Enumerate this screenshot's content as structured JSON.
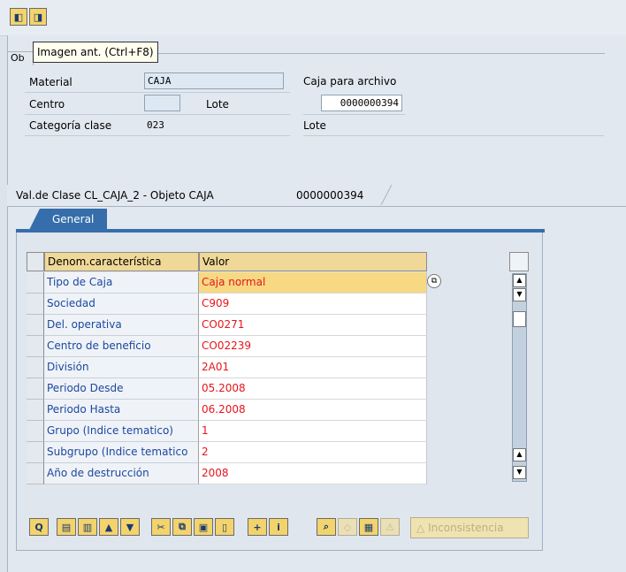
{
  "toolbar": {
    "prev_icon": "previous-screen-icon",
    "next_icon": "next-screen-icon",
    "tooltip": "Imagen ant.  (Ctrl+F8)"
  },
  "object": {
    "group_label": "Ob",
    "material_label": "Material",
    "material_value": "CAJA",
    "caja_archivo_label": "Caja para archivo",
    "centro_label": "Centro",
    "centro_value": "",
    "lote_label": "Lote",
    "lote_value": "0000000394",
    "categoria_label": "Categoría clase",
    "categoria_value": "023",
    "lote2_label": "Lote"
  },
  "section": {
    "title": "Val.de Clase CL_CAJA_2 - Objeto CAJA",
    "value": "0000000394",
    "tab_general": "General"
  },
  "table": {
    "header_name": "Denom.característica",
    "header_value": "Valor",
    "rows": [
      {
        "name": "Tipo de Caja",
        "value": "Caja normal"
      },
      {
        "name": "Sociedad",
        "value": "C909"
      },
      {
        "name": "Del. operativa",
        "value": "CO0271"
      },
      {
        "name": "Centro de beneficio",
        "value": "CO02239"
      },
      {
        "name": "División",
        "value": "2A01"
      },
      {
        "name": "Periodo Desde",
        "value": "05.2008"
      },
      {
        "name": "Periodo Hasta",
        "value": "06.2008"
      },
      {
        "name": "Grupo (Indice tematico)",
        "value": "1"
      },
      {
        "name": "Subgrupo (Indice tematico",
        "value": "2"
      },
      {
        "name": "Año de destrucción",
        "value": "2008"
      }
    ]
  },
  "bottom_toolbar": {
    "inconsistencia_label": "Inconsistencia"
  },
  "colors": {
    "accent_blue": "#356eaa",
    "value_red": "#e8141b",
    "name_blue": "#1c47a0",
    "header_yellow": "#f0d898"
  }
}
